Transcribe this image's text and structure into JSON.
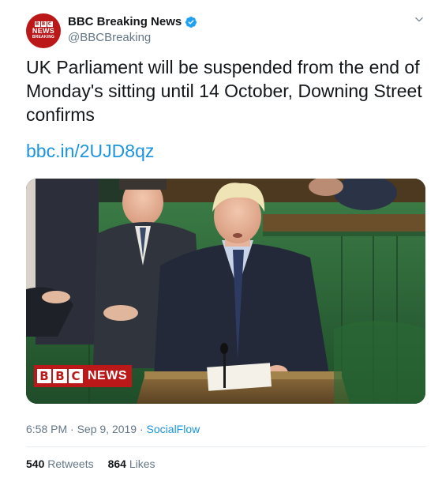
{
  "account": {
    "display_name": "BBC Breaking News",
    "handle": "@BBCBreaking",
    "verified": true,
    "avatar": {
      "blocks": [
        "B",
        "B",
        "C"
      ],
      "line1": "NEWS",
      "line2": "BREAKING"
    }
  },
  "tweet": {
    "text": "UK Parliament will be suspended from the end of Monday's sitting until 14 October, Downing Street confirms",
    "link": "bbc.in/2UJD8qz"
  },
  "media": {
    "badge_blocks": [
      "B",
      "B",
      "C"
    ],
    "badge_word": "NEWS"
  },
  "meta": {
    "timestamp": "6:58 PM · Sep 9, 2019",
    "separator": " · ",
    "source": "SocialFlow"
  },
  "stats": {
    "retweets_count": "540",
    "retweets_label": "Retweets",
    "likes_count": "864",
    "likes_label": "Likes"
  },
  "colors": {
    "brand_red": "#bb1919",
    "link_blue": "#1b95e0",
    "verified_blue": "#1da1f2",
    "muted_text": "#657786",
    "bench_green": "#2f6b3a"
  },
  "icons": {
    "verified": "verified-badge-icon",
    "caret": "chevron-down-icon"
  }
}
